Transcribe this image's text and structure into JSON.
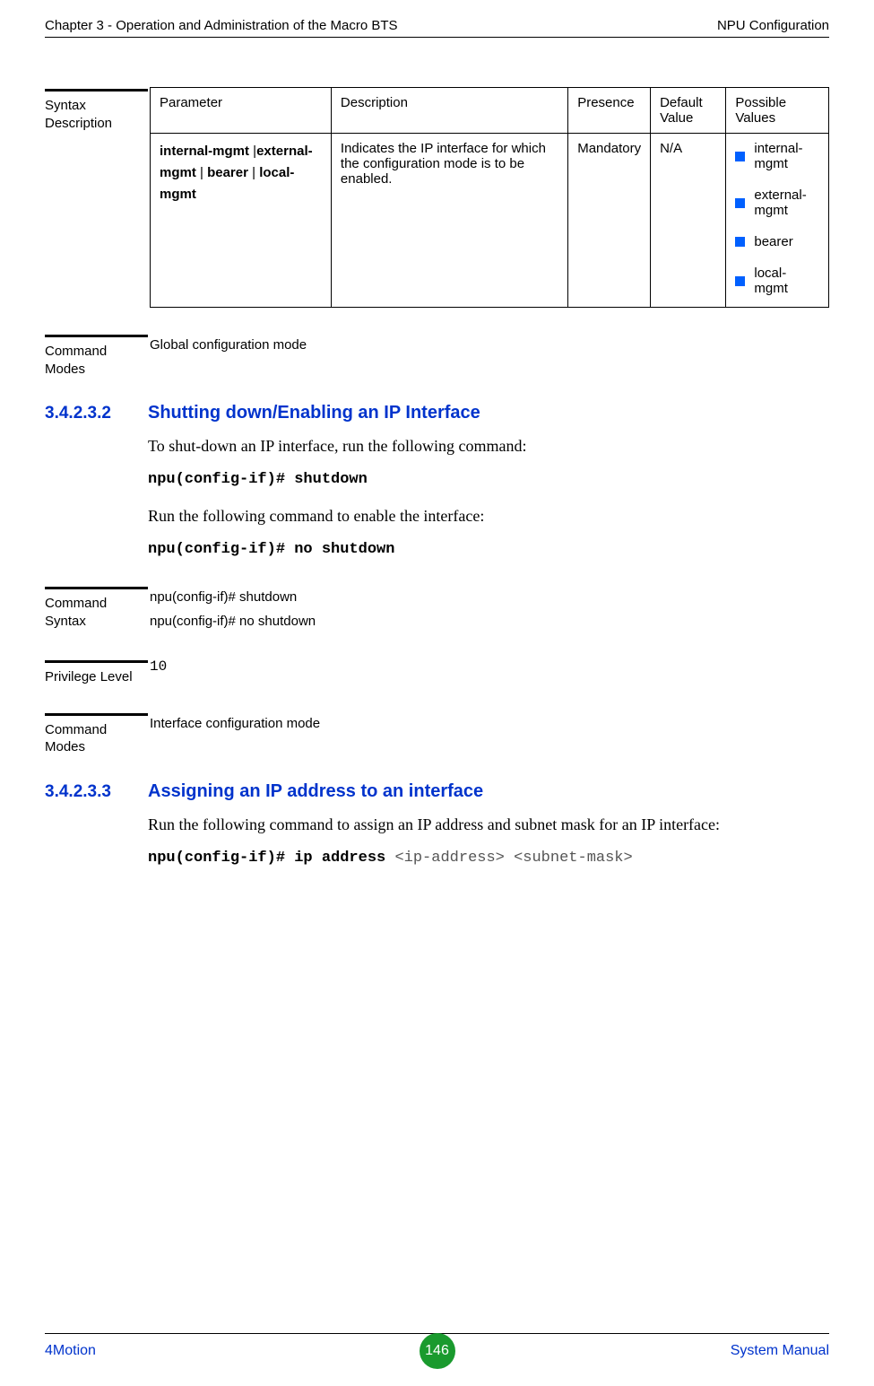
{
  "header": {
    "left": "Chapter 3 - Operation and Administration of the Macro BTS",
    "right": "NPU Configuration"
  },
  "syntax_desc_label": "Syntax Description",
  "table": {
    "headers": [
      "Parameter",
      "Description",
      "Presence",
      "Default Value",
      "Possible Values"
    ],
    "row": {
      "param_parts": [
        "internal-mgmt",
        " |",
        "external-mgmt",
        " | ",
        "bearer",
        " | ",
        "local-mgmt"
      ],
      "description": "Indicates the IP interface for which the configuration mode is to be enabled.",
      "presence": "Mandatory",
      "default": "N/A",
      "possible_values": [
        "internal-mgmt",
        "external-mgmt",
        "bearer",
        "local-mgmt"
      ]
    }
  },
  "cmd_modes_label": "Command Modes",
  "cmd_modes_1_text": "Global configuration mode",
  "sec1": {
    "num": "3.4.2.3.2",
    "title": "Shutting down/Enabling an IP Interface",
    "p1": "To shut-down an IP interface, run the following command:",
    "code1": "npu(config-if)# shutdown",
    "p2": "Run the following command to enable the interface:",
    "code2": "npu(config-if)# no shutdown"
  },
  "cmd_syntax_label": "Command Syntax",
  "cmd_syntax_lines": [
    "npu(config-if)# shutdown",
    "npu(config-if)# no shutdown"
  ],
  "priv_label": "Privilege Level",
  "priv_value": "10",
  "cmd_modes_2_text": "Interface configuration mode",
  "sec2": {
    "num": "3.4.2.3.3",
    "title": "Assigning an IP address to an interface",
    "p1": "Run the following command to assign an IP address and subnet mask for an IP interface:",
    "code_prefix": "npu(config-if)# ip address ",
    "code_args": "<ip-address> <subnet-mask>"
  },
  "footer": {
    "left": "4Motion",
    "page": "146",
    "right": "System Manual"
  }
}
